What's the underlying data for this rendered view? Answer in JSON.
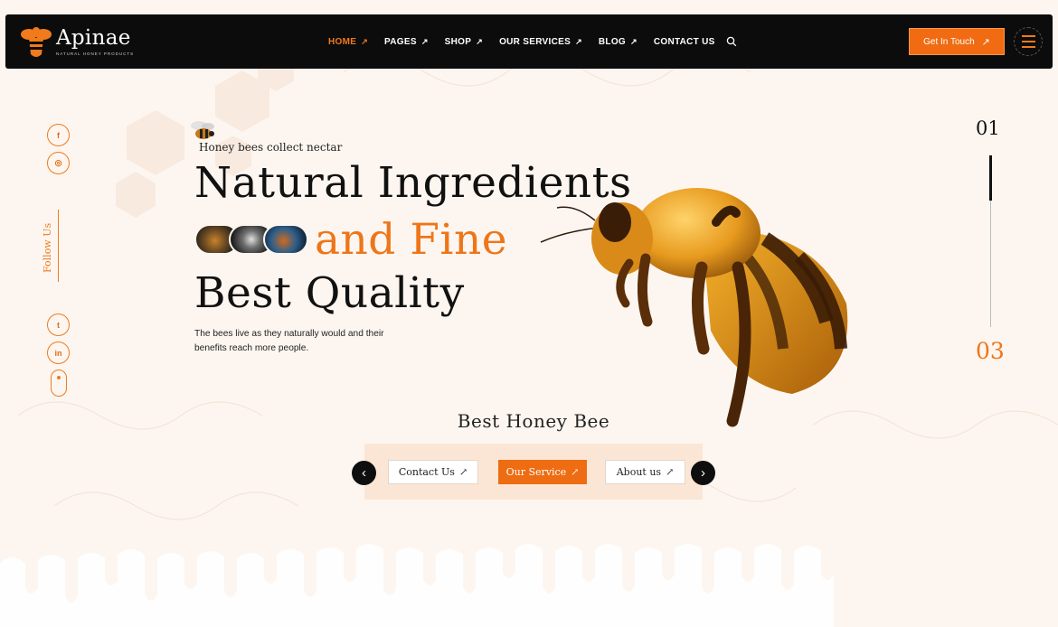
{
  "brand": {
    "name": "Apinae",
    "tagline": "NATURAL HONEY PRODUCTS"
  },
  "nav": {
    "items": [
      {
        "label": "HOME",
        "arrow": "↗",
        "active": true
      },
      {
        "label": "PAGES",
        "arrow": "↗"
      },
      {
        "label": "SHOP",
        "arrow": "↗"
      },
      {
        "label": "OUR SERVICES",
        "arrow": "↗"
      },
      {
        "label": "BLOG",
        "arrow": "↗"
      },
      {
        "label": "CONTACT US",
        "arrow": ""
      }
    ],
    "search_icon": "search-icon",
    "cta_label": "Get In Touch",
    "cta_arrow": "↗",
    "menu_icon": "hamburger-icon"
  },
  "social": {
    "follow_label": "Follow Us",
    "icons": [
      {
        "name": "facebook-icon",
        "glyph": "f"
      },
      {
        "name": "instagram-icon",
        "glyph": "◎"
      },
      {
        "name": "twitter-icon",
        "glyph": "t"
      },
      {
        "name": "linkedin-icon",
        "glyph": "in"
      }
    ]
  },
  "hero": {
    "eyebrow": "Honey bees collect nectar",
    "line1": "Natural Ingredients",
    "line2": "and Fine",
    "line3": "Best Quality",
    "description": "The bees live as they naturally would and their benefits reach more people."
  },
  "slider": {
    "current": "01",
    "total": "03"
  },
  "section": {
    "title": "Best Honey Bee",
    "prev_glyph": "‹",
    "next_glyph": "›",
    "buttons": [
      {
        "label": "Contact Us",
        "arrow": "↗"
      },
      {
        "label": "Our Service",
        "arrow": "↗"
      },
      {
        "label": "About us",
        "arrow": "↗"
      }
    ]
  },
  "colors": {
    "accent": "#ee7619",
    "header_bg": "#0c0c0c",
    "page_bg": "#fdf6f0",
    "panel_bg": "#fbe6d6"
  }
}
